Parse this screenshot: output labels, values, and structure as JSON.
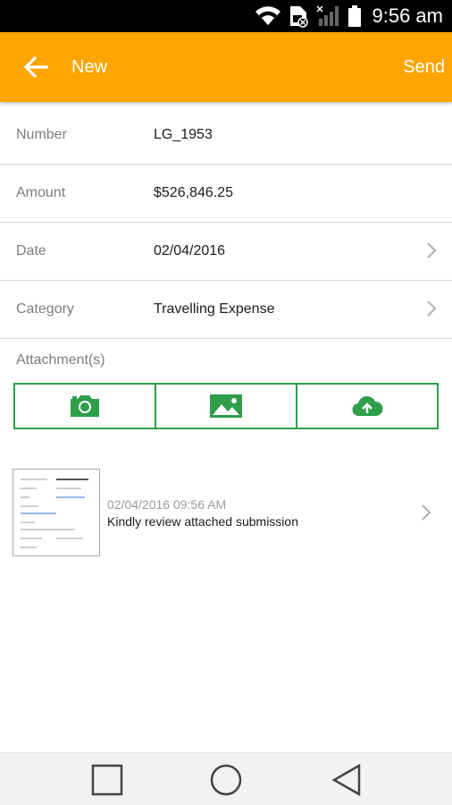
{
  "status_bar": {
    "time": "9:56 am"
  },
  "app_bar": {
    "title": "New",
    "send_label": "Send"
  },
  "form": {
    "rows": [
      {
        "label": "Number",
        "value": "LG_1953",
        "has_chevron": false
      },
      {
        "label": "Amount",
        "value": "$526,846.25",
        "has_chevron": false
      },
      {
        "label": "Date",
        "value": "02/04/2016",
        "has_chevron": true
      },
      {
        "label": "Category",
        "value": "Travelling Expense",
        "has_chevron": true
      }
    ]
  },
  "attachments": {
    "label": "Attachment(s)",
    "buttons": [
      "camera-icon",
      "gallery-icon",
      "cloud-upload-icon"
    ],
    "accent_color": "#2e9e4a"
  },
  "entries": [
    {
      "timestamp": "02/04/2016 09:56 AM",
      "text": "Kindly review attached submission"
    }
  ],
  "colors": {
    "app_bar": "#ffa500",
    "accent": "#2e9e4a"
  }
}
